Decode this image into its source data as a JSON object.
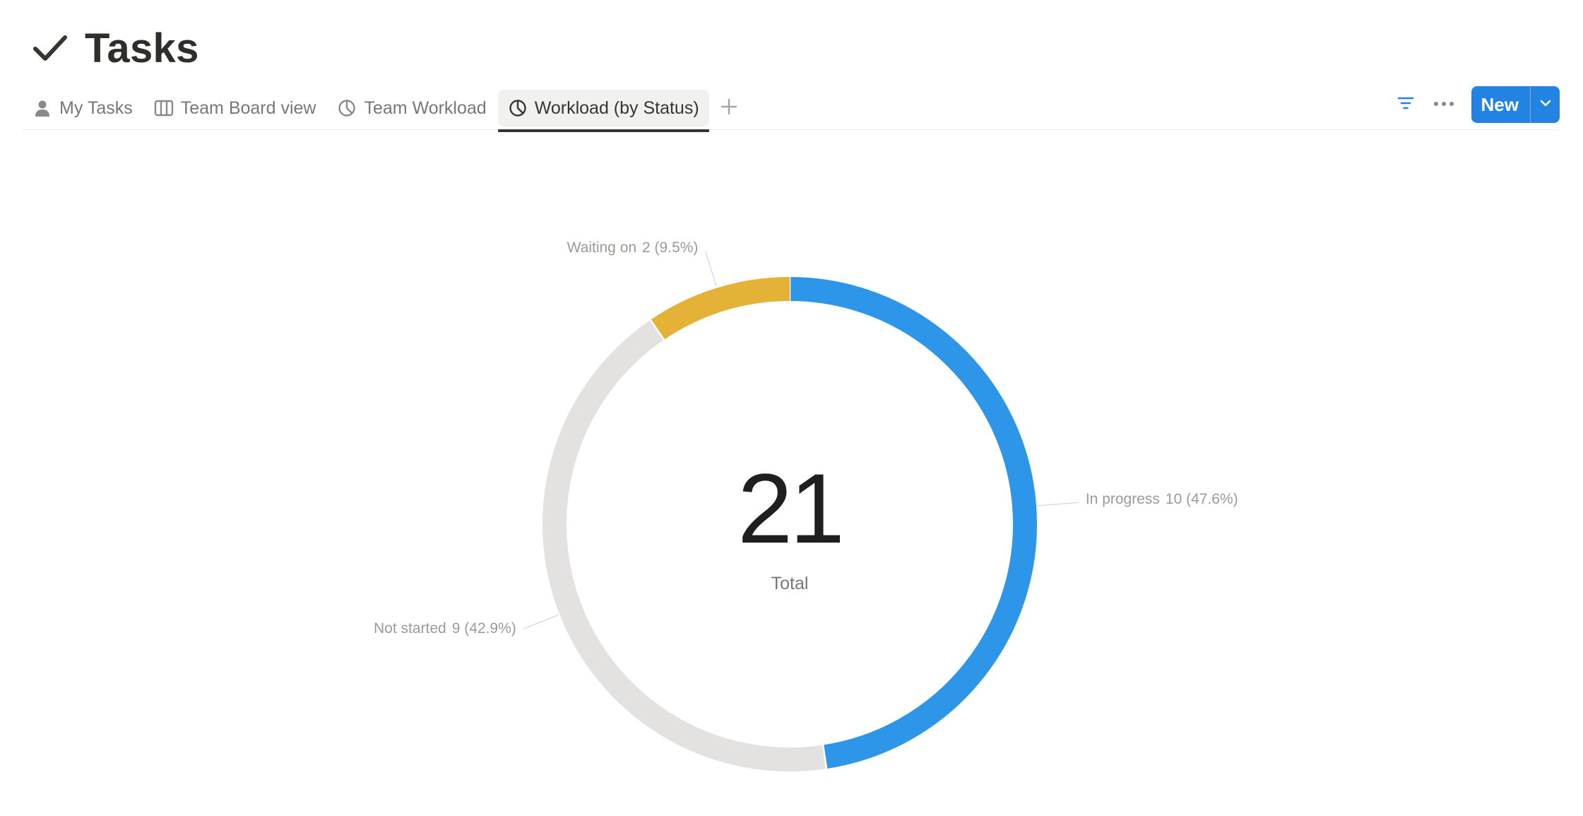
{
  "page": {
    "title": "Tasks",
    "title_icon": "checkmark-icon"
  },
  "tabs": [
    {
      "label": "My Tasks",
      "icon": "person-icon",
      "active": false
    },
    {
      "label": "Team Board view",
      "icon": "board-columns-icon",
      "active": false
    },
    {
      "label": "Team Workload",
      "icon": "pie-chart-icon",
      "active": false
    },
    {
      "label": "Workload (by Status)",
      "icon": "pie-chart-icon",
      "active": true
    }
  ],
  "toolbar": {
    "add_view_icon": "plus-icon",
    "filter_icon": "filter-icon",
    "more_icon": "more-dots-icon",
    "new_label": "New",
    "new_dropdown_icon": "chevron-down-icon"
  },
  "colors": {
    "accent": "#2383e2",
    "in_progress": "#2e96e8",
    "waiting_on": "#e3b236",
    "not_started": "#e3e2e0"
  },
  "chart_data": {
    "type": "pie",
    "donut": true,
    "center_value": "21",
    "center_label": "Total",
    "total": 21,
    "slices": [
      {
        "name": "In progress",
        "value": 10,
        "value_text": "10 (47.6%)",
        "color": "#2e96e8"
      },
      {
        "name": "Not started",
        "value": 9,
        "value_text": "9 (42.9%)",
        "color": "#e3e2e0"
      },
      {
        "name": "Waiting on",
        "value": 2,
        "value_text": "2 (9.5%)",
        "color": "#e3b236"
      }
    ]
  }
}
